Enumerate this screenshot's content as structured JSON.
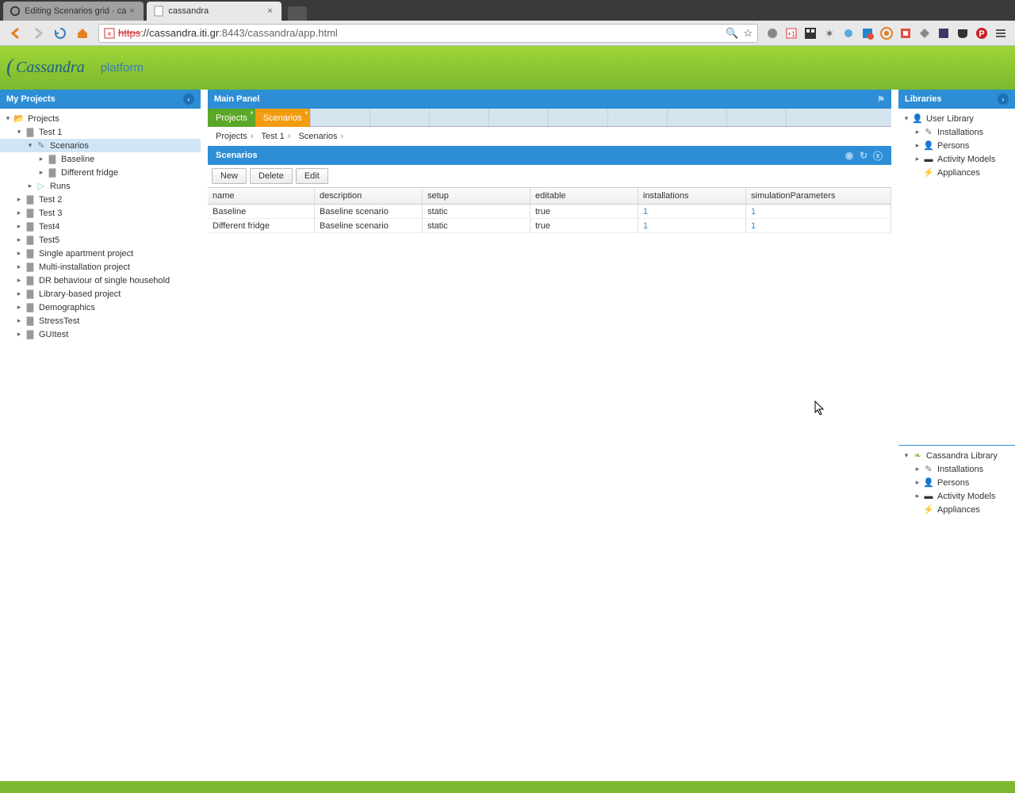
{
  "browser": {
    "tabs": [
      {
        "title": "Editing Scenarios grid · ca",
        "icon": "github"
      },
      {
        "title": "cassandra",
        "icon": "page"
      }
    ],
    "url_protocol": "https",
    "url_host": "://cassandra.iti.gr",
    "url_port": ":8443",
    "url_path": "/cassandra/app.html"
  },
  "header": {
    "logo": "Cassandra",
    "platform": "platform"
  },
  "left": {
    "title": "My Projects",
    "root": "Projects",
    "items": [
      {
        "label": "Test 1",
        "children": [
          {
            "label": "Scenarios",
            "selected": true,
            "children": [
              {
                "label": "Baseline"
              },
              {
                "label": "Different fridge"
              }
            ]
          },
          {
            "label": "Runs",
            "icon": "flag"
          }
        ]
      },
      {
        "label": "Test 2"
      },
      {
        "label": "Test 3"
      },
      {
        "label": "Test4"
      },
      {
        "label": "Test5"
      },
      {
        "label": "Single apartment project"
      },
      {
        "label": "Multi-installation project"
      },
      {
        "label": "DR behaviour of single household"
      },
      {
        "label": "Library-based project"
      },
      {
        "label": "Demographics"
      },
      {
        "label": "StressTest"
      },
      {
        "label": "GUItest"
      }
    ]
  },
  "center": {
    "title": "Main Panel",
    "tabs": [
      {
        "label": "Projects",
        "style": "green"
      },
      {
        "label": "Scenarios",
        "style": "orange"
      }
    ],
    "breadcrumb": [
      "Projects",
      "Test 1",
      "Scenarios"
    ],
    "section_title": "Scenarios",
    "buttons": {
      "new": "New",
      "del": "Delete",
      "edit": "Edit"
    },
    "columns": {
      "name": "name",
      "desc": "description",
      "setup": "setup",
      "editable": "editable",
      "inst": "installations",
      "sim": "simulationParameters"
    },
    "rows": [
      {
        "name": "Baseline",
        "desc": "Baseline scenario",
        "setup": "static",
        "editable": "true",
        "inst": "1",
        "sim": "1"
      },
      {
        "name": "Different fridge",
        "desc": "Baseline scenario",
        "setup": "static",
        "editable": "true",
        "inst": "1",
        "sim": "1"
      }
    ]
  },
  "right": {
    "title": "Libraries",
    "user_lib": "User Library",
    "cass_lib": "Cassandra Library",
    "items": [
      "Installations",
      "Persons",
      "Activity Models",
      "Appliances"
    ]
  }
}
